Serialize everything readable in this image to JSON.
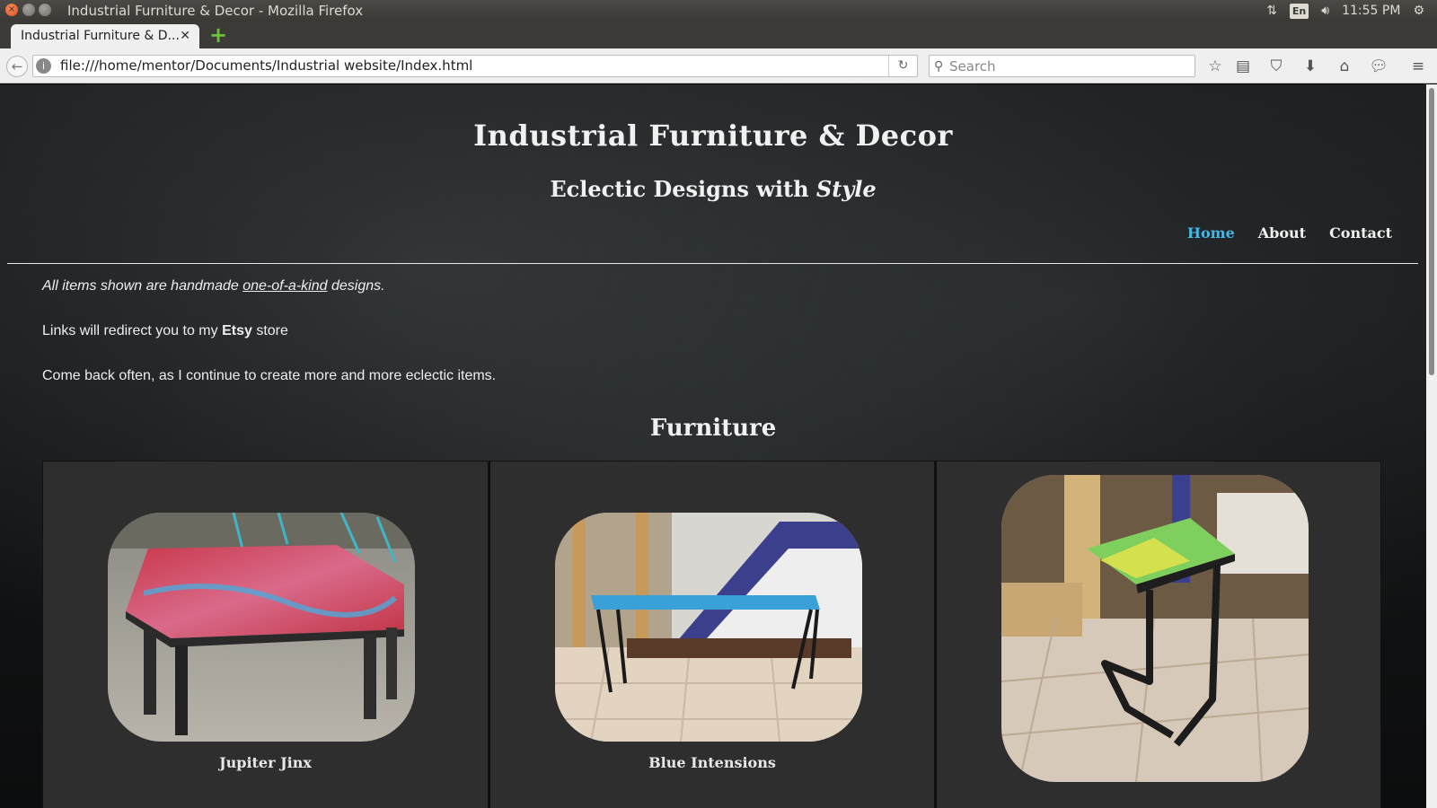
{
  "window": {
    "title": "Industrial Furniture & Decor - Mozilla Firefox",
    "clock": "11:55 PM",
    "lang": "En"
  },
  "tabs": [
    {
      "label": "Industrial Furniture & D..."
    }
  ],
  "navbar": {
    "url": "file:///home/mentor/Documents/Industrial website/Index.html",
    "search_placeholder": "Search"
  },
  "page": {
    "title": "Industrial Furniture & Decor",
    "tagline_main": "Eclectic Designs with",
    "tagline_em": "Style",
    "nav": [
      {
        "label": "Home",
        "active": true
      },
      {
        "label": "About",
        "active": false
      },
      {
        "label": "Contact",
        "active": false
      }
    ],
    "intro": {
      "line1_prefix": "All items shown are handmade",
      "line1_link": "one-of-a-kind",
      "line1_suffix": "designs.",
      "line2_prefix": "Links will redirect you to my",
      "line2_bold": "Etsy",
      "line2_suffix": "store",
      "line3": "Come back often, as I continue to create more and more eclectic items."
    },
    "section_heading": "Furniture",
    "products": [
      {
        "name": "Jupiter Jinx"
      },
      {
        "name": "Blue Intensions"
      },
      {
        "name": ""
      }
    ]
  },
  "colors": {
    "nav_active": "#47b6e5",
    "card_bg": "#2e2e2e",
    "text": "#f1f1f1"
  }
}
